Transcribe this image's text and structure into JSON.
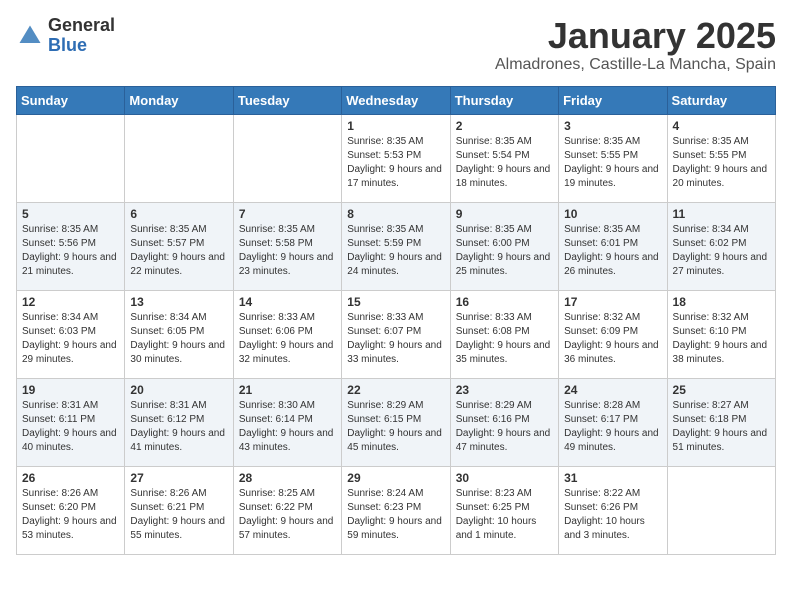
{
  "header": {
    "logo_general": "General",
    "logo_blue": "Blue",
    "month_title": "January 2025",
    "location": "Almadrones, Castille-La Mancha, Spain"
  },
  "weekdays": [
    "Sunday",
    "Monday",
    "Tuesday",
    "Wednesday",
    "Thursday",
    "Friday",
    "Saturday"
  ],
  "weeks": [
    [
      {
        "day": "",
        "sunrise": "",
        "sunset": "",
        "daylight": ""
      },
      {
        "day": "",
        "sunrise": "",
        "sunset": "",
        "daylight": ""
      },
      {
        "day": "",
        "sunrise": "",
        "sunset": "",
        "daylight": ""
      },
      {
        "day": "1",
        "sunrise": "Sunrise: 8:35 AM",
        "sunset": "Sunset: 5:53 PM",
        "daylight": "Daylight: 9 hours and 17 minutes."
      },
      {
        "day": "2",
        "sunrise": "Sunrise: 8:35 AM",
        "sunset": "Sunset: 5:54 PM",
        "daylight": "Daylight: 9 hours and 18 minutes."
      },
      {
        "day": "3",
        "sunrise": "Sunrise: 8:35 AM",
        "sunset": "Sunset: 5:55 PM",
        "daylight": "Daylight: 9 hours and 19 minutes."
      },
      {
        "day": "4",
        "sunrise": "Sunrise: 8:35 AM",
        "sunset": "Sunset: 5:55 PM",
        "daylight": "Daylight: 9 hours and 20 minutes."
      }
    ],
    [
      {
        "day": "5",
        "sunrise": "Sunrise: 8:35 AM",
        "sunset": "Sunset: 5:56 PM",
        "daylight": "Daylight: 9 hours and 21 minutes."
      },
      {
        "day": "6",
        "sunrise": "Sunrise: 8:35 AM",
        "sunset": "Sunset: 5:57 PM",
        "daylight": "Daylight: 9 hours and 22 minutes."
      },
      {
        "day": "7",
        "sunrise": "Sunrise: 8:35 AM",
        "sunset": "Sunset: 5:58 PM",
        "daylight": "Daylight: 9 hours and 23 minutes."
      },
      {
        "day": "8",
        "sunrise": "Sunrise: 8:35 AM",
        "sunset": "Sunset: 5:59 PM",
        "daylight": "Daylight: 9 hours and 24 minutes."
      },
      {
        "day": "9",
        "sunrise": "Sunrise: 8:35 AM",
        "sunset": "Sunset: 6:00 PM",
        "daylight": "Daylight: 9 hours and 25 minutes."
      },
      {
        "day": "10",
        "sunrise": "Sunrise: 8:35 AM",
        "sunset": "Sunset: 6:01 PM",
        "daylight": "Daylight: 9 hours and 26 minutes."
      },
      {
        "day": "11",
        "sunrise": "Sunrise: 8:34 AM",
        "sunset": "Sunset: 6:02 PM",
        "daylight": "Daylight: 9 hours and 27 minutes."
      }
    ],
    [
      {
        "day": "12",
        "sunrise": "Sunrise: 8:34 AM",
        "sunset": "Sunset: 6:03 PM",
        "daylight": "Daylight: 9 hours and 29 minutes."
      },
      {
        "day": "13",
        "sunrise": "Sunrise: 8:34 AM",
        "sunset": "Sunset: 6:05 PM",
        "daylight": "Daylight: 9 hours and 30 minutes."
      },
      {
        "day": "14",
        "sunrise": "Sunrise: 8:33 AM",
        "sunset": "Sunset: 6:06 PM",
        "daylight": "Daylight: 9 hours and 32 minutes."
      },
      {
        "day": "15",
        "sunrise": "Sunrise: 8:33 AM",
        "sunset": "Sunset: 6:07 PM",
        "daylight": "Daylight: 9 hours and 33 minutes."
      },
      {
        "day": "16",
        "sunrise": "Sunrise: 8:33 AM",
        "sunset": "Sunset: 6:08 PM",
        "daylight": "Daylight: 9 hours and 35 minutes."
      },
      {
        "day": "17",
        "sunrise": "Sunrise: 8:32 AM",
        "sunset": "Sunset: 6:09 PM",
        "daylight": "Daylight: 9 hours and 36 minutes."
      },
      {
        "day": "18",
        "sunrise": "Sunrise: 8:32 AM",
        "sunset": "Sunset: 6:10 PM",
        "daylight": "Daylight: 9 hours and 38 minutes."
      }
    ],
    [
      {
        "day": "19",
        "sunrise": "Sunrise: 8:31 AM",
        "sunset": "Sunset: 6:11 PM",
        "daylight": "Daylight: 9 hours and 40 minutes."
      },
      {
        "day": "20",
        "sunrise": "Sunrise: 8:31 AM",
        "sunset": "Sunset: 6:12 PM",
        "daylight": "Daylight: 9 hours and 41 minutes."
      },
      {
        "day": "21",
        "sunrise": "Sunrise: 8:30 AM",
        "sunset": "Sunset: 6:14 PM",
        "daylight": "Daylight: 9 hours and 43 minutes."
      },
      {
        "day": "22",
        "sunrise": "Sunrise: 8:29 AM",
        "sunset": "Sunset: 6:15 PM",
        "daylight": "Daylight: 9 hours and 45 minutes."
      },
      {
        "day": "23",
        "sunrise": "Sunrise: 8:29 AM",
        "sunset": "Sunset: 6:16 PM",
        "daylight": "Daylight: 9 hours and 47 minutes."
      },
      {
        "day": "24",
        "sunrise": "Sunrise: 8:28 AM",
        "sunset": "Sunset: 6:17 PM",
        "daylight": "Daylight: 9 hours and 49 minutes."
      },
      {
        "day": "25",
        "sunrise": "Sunrise: 8:27 AM",
        "sunset": "Sunset: 6:18 PM",
        "daylight": "Daylight: 9 hours and 51 minutes."
      }
    ],
    [
      {
        "day": "26",
        "sunrise": "Sunrise: 8:26 AM",
        "sunset": "Sunset: 6:20 PM",
        "daylight": "Daylight: 9 hours and 53 minutes."
      },
      {
        "day": "27",
        "sunrise": "Sunrise: 8:26 AM",
        "sunset": "Sunset: 6:21 PM",
        "daylight": "Daylight: 9 hours and 55 minutes."
      },
      {
        "day": "28",
        "sunrise": "Sunrise: 8:25 AM",
        "sunset": "Sunset: 6:22 PM",
        "daylight": "Daylight: 9 hours and 57 minutes."
      },
      {
        "day": "29",
        "sunrise": "Sunrise: 8:24 AM",
        "sunset": "Sunset: 6:23 PM",
        "daylight": "Daylight: 9 hours and 59 minutes."
      },
      {
        "day": "30",
        "sunrise": "Sunrise: 8:23 AM",
        "sunset": "Sunset: 6:25 PM",
        "daylight": "Daylight: 10 hours and 1 minute."
      },
      {
        "day": "31",
        "sunrise": "Sunrise: 8:22 AM",
        "sunset": "Sunset: 6:26 PM",
        "daylight": "Daylight: 10 hours and 3 minutes."
      },
      {
        "day": "",
        "sunrise": "",
        "sunset": "",
        "daylight": ""
      }
    ]
  ]
}
